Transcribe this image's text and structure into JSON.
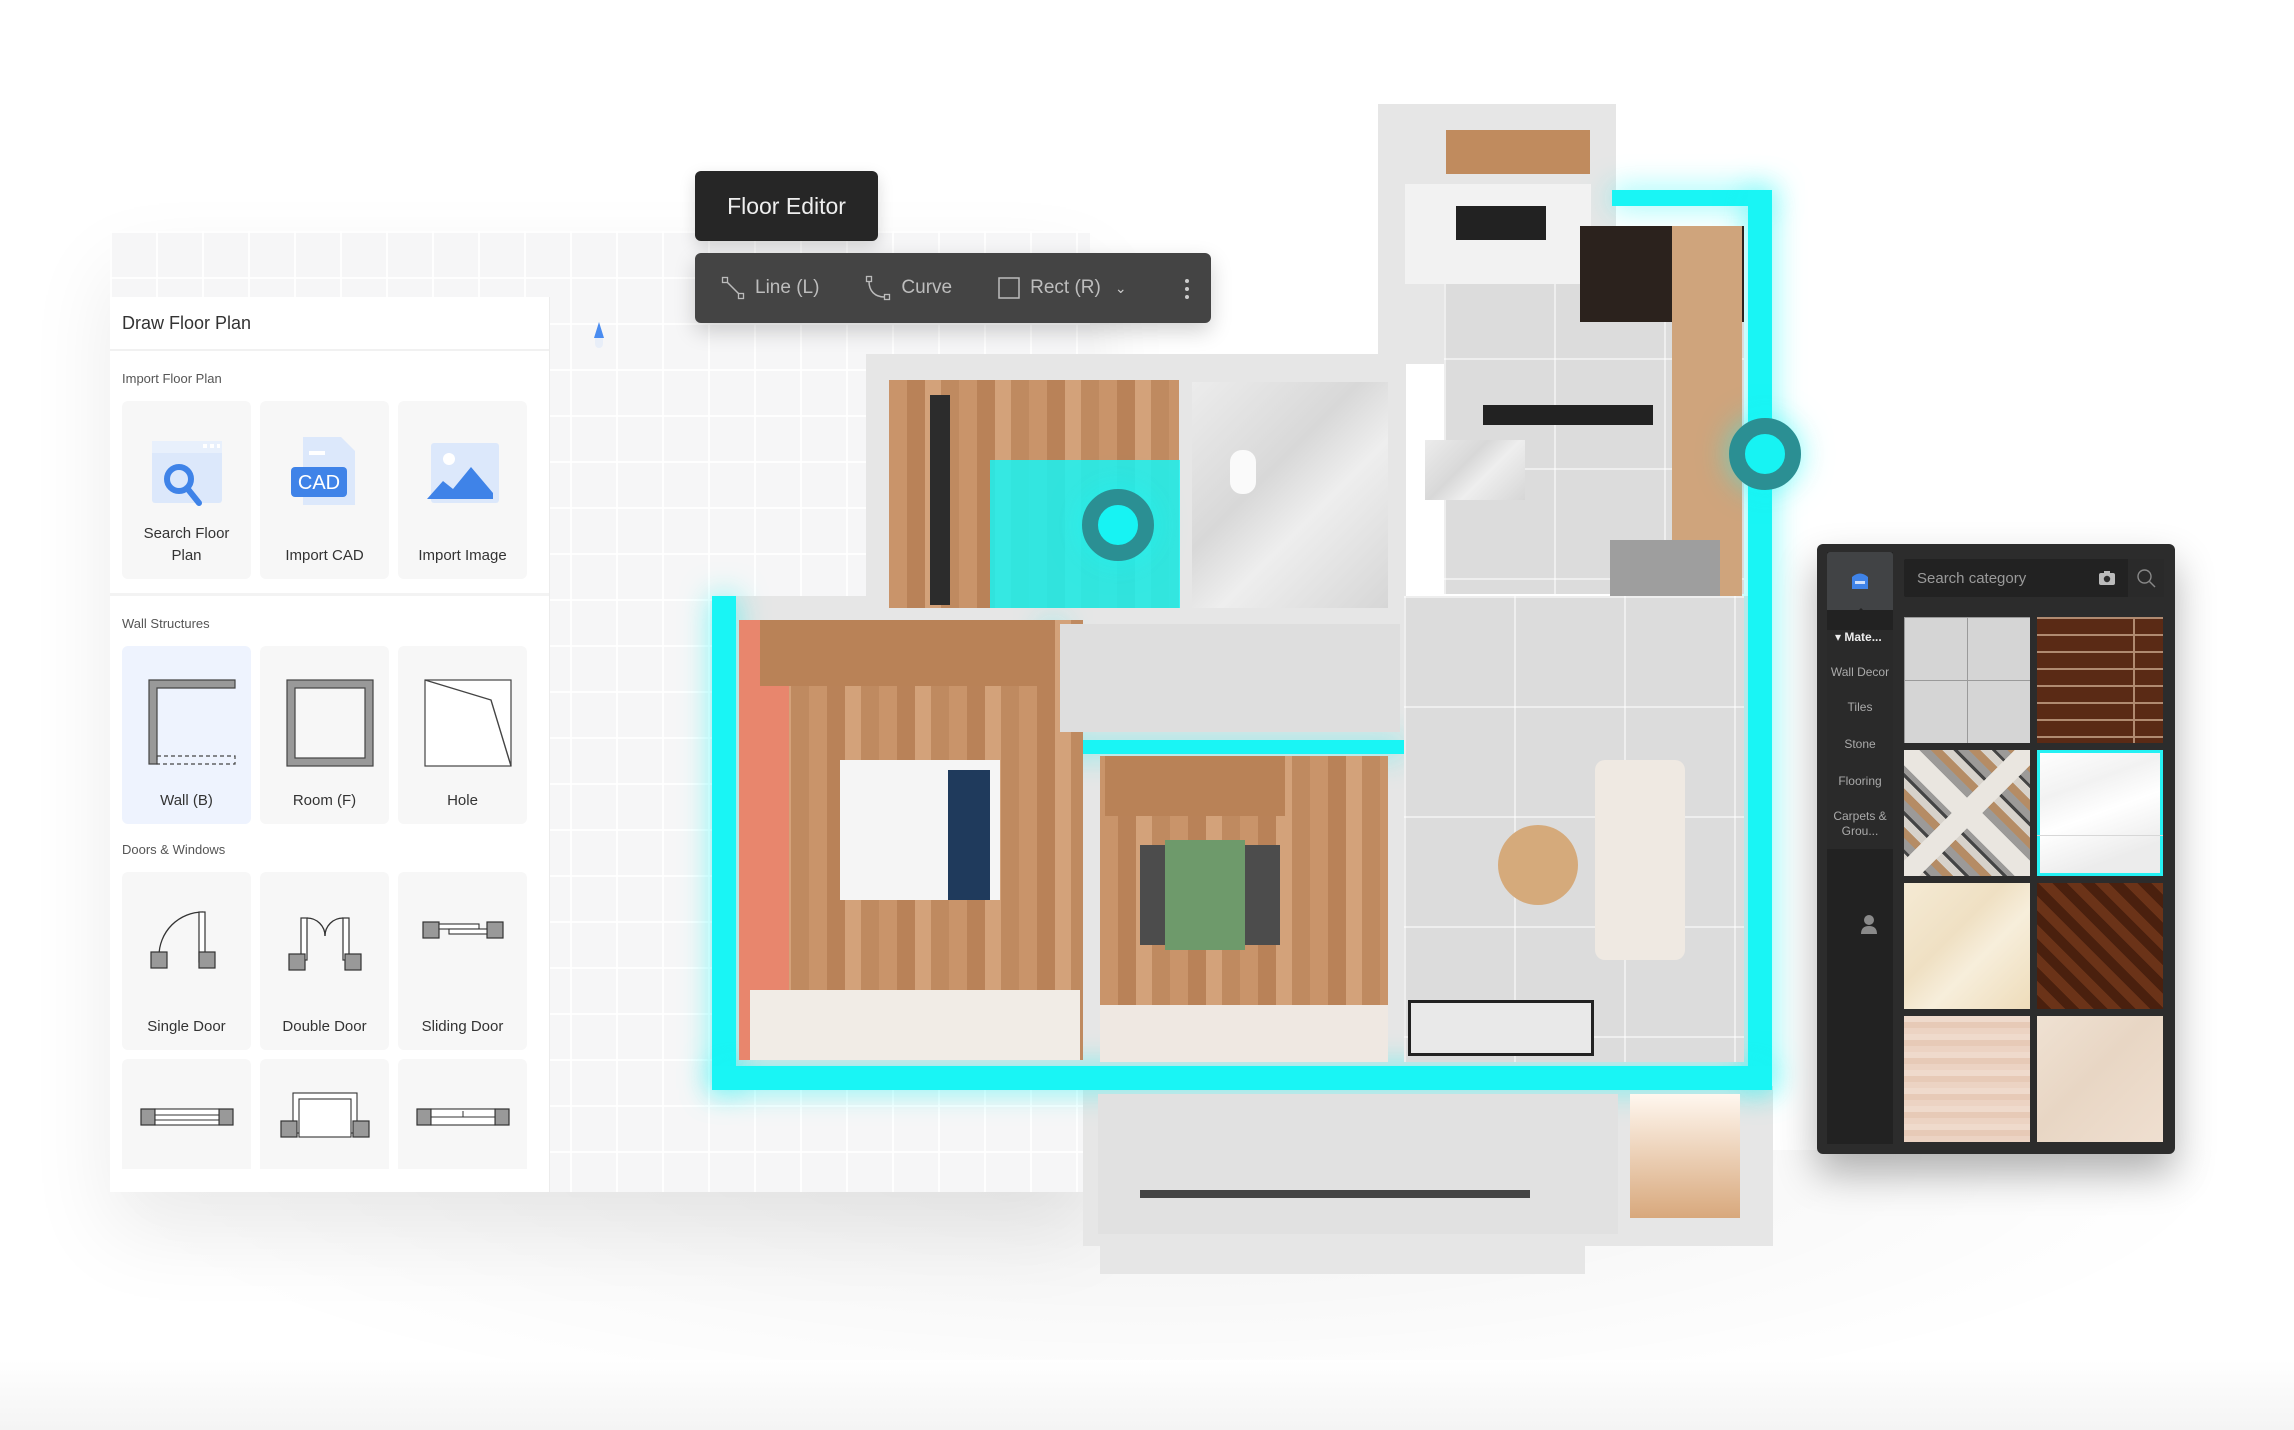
{
  "editor": {
    "tooltip": "Floor Editor",
    "tools": [
      {
        "label": "Line (L)",
        "icon": "line-tool-icon"
      },
      {
        "label": "Curve",
        "icon": "curve-tool-icon"
      },
      {
        "label": "Rect (R)",
        "icon": "rect-tool-icon",
        "has_dropdown": true
      }
    ],
    "more_icon": "more-vertical-icon"
  },
  "sidebar": {
    "title": "Draw Floor Plan",
    "sections": [
      {
        "title": "Import Floor Plan",
        "items": [
          {
            "label": "Search Floor Plan",
            "icon": "search-floor-plan-icon"
          },
          {
            "label": "Import CAD",
            "icon": "cad-file-icon",
            "icon_text": "CAD"
          },
          {
            "label": "Import Image",
            "icon": "image-icon"
          }
        ]
      },
      {
        "title": "Wall Structures",
        "items": [
          {
            "label": "Wall (B)",
            "icon": "wall-icon",
            "active": true
          },
          {
            "label": "Room (F)",
            "icon": "room-icon"
          },
          {
            "label": "Hole",
            "icon": "hole-icon"
          }
        ]
      },
      {
        "title": "Doors & Windows",
        "items": [
          {
            "label": "Single Door",
            "icon": "single-door-icon"
          },
          {
            "label": "Double Door",
            "icon": "double-door-icon"
          },
          {
            "label": "Sliding Door",
            "icon": "sliding-door-icon"
          },
          {
            "label": "",
            "icon": "window-icon"
          },
          {
            "label": "",
            "icon": "bay-window-icon"
          },
          {
            "label": "",
            "icon": "double-window-icon"
          }
        ]
      }
    ]
  },
  "materials": {
    "search_placeholder": "Search category",
    "categories": [
      {
        "label": "Mate...",
        "expanded": true
      },
      {
        "label": "Wall Decor"
      },
      {
        "label": "Tiles"
      },
      {
        "label": "Stone"
      },
      {
        "label": "Flooring"
      },
      {
        "label": "Carpets & Grou..."
      }
    ],
    "swatches": [
      {
        "name": "concrete-tile"
      },
      {
        "name": "dark-wood-planks"
      },
      {
        "name": "chevron-wood"
      },
      {
        "name": "white-marble",
        "selected": true
      },
      {
        "name": "cream-marble"
      },
      {
        "name": "herringbone-wood"
      },
      {
        "name": "light-wood"
      },
      {
        "name": "beige-stone"
      }
    ],
    "accent": "#25f1f4"
  },
  "colors": {
    "highlight": "#19f5f5",
    "handle_ring": "#2b8f93",
    "toolbar_bg": "#444444",
    "tooltip_bg": "#262626",
    "active_tile": "#eef3fe"
  }
}
